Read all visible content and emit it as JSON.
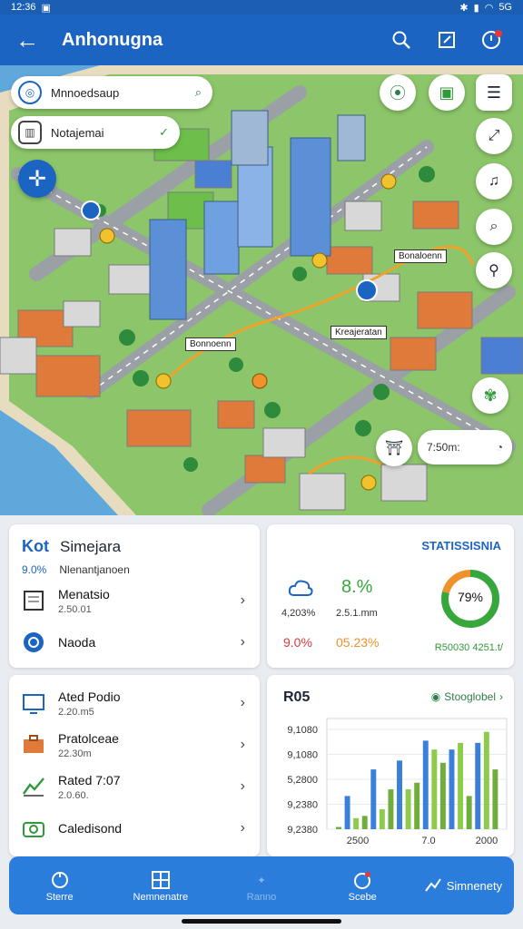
{
  "status_bar": {
    "left_text": "12:36",
    "right_text": "5G"
  },
  "app_bar": {
    "title": "Anhonugna"
  },
  "map": {
    "search_1": "Mnnoedsaup",
    "search_2": "Notajemai",
    "labels": {
      "a": "Bonaloenn",
      "b": "Bonnoenn",
      "c": "Kreajeratan"
    },
    "time_pill": "7:50m:"
  },
  "card_list": {
    "title_prefix": "Kot",
    "title": "Simejara",
    "sub_pct": "9.0%",
    "sub_text": "Nlenantjanoen",
    "items": [
      {
        "label": "Menatsio",
        "sub": "2.50.01"
      },
      {
        "label": "Naoda",
        "sub": ""
      }
    ]
  },
  "card_stats": {
    "title": "STATISSISNIA",
    "big_value": "8.%",
    "val_left": "4,203%",
    "val_right": "2.5.1.mm",
    "red_val": "9.0%",
    "orange_val": "05.23%",
    "donut_text": "79%",
    "footer": "R50030 4251.t/",
    "donut_value": 79,
    "colors": {
      "green": "#35a73b",
      "blue": "#1c64c2",
      "orange": "#f0922b",
      "red": "#d93a3a"
    }
  },
  "card_list2": {
    "items": [
      {
        "label": "Ated Podio",
        "sub": "2.20.m5"
      },
      {
        "label": "Pratolceae",
        "sub": "22.30m"
      },
      {
        "label": "Rated 7:07",
        "sub": "2.0.60."
      },
      {
        "label": "Caledisond",
        "sub": ""
      }
    ]
  },
  "card_chart": {
    "title": "R05",
    "link": "Stooglobel",
    "chart_data": {
      "type": "bar",
      "title": "",
      "xlabel": "",
      "ylabel": "",
      "ytick_labels": [
        "9,1080",
        "9,1080",
        "5,2800",
        "9,2380",
        "9,2380"
      ],
      "xtick_labels": [
        "2500",
        "7.0",
        "2000"
      ],
      "series": [
        {
          "values": [
            1,
            6,
            18,
            21,
            30,
            15,
            27
          ]
        },
        {
          "values": [
            15,
            27,
            31,
            40,
            36,
            39
          ]
        },
        {
          "values": [
            5,
            9,
            18,
            36,
            39,
            44
          ]
        }
      ],
      "ylim": [
        0,
        50
      ]
    }
  },
  "bottom_nav": {
    "items": [
      {
        "label": "Sterre"
      },
      {
        "label": "Nemnenatre"
      },
      {
        "label": "Ranno"
      },
      {
        "label": "Scebe"
      },
      {
        "label": "Simnenety"
      }
    ]
  }
}
